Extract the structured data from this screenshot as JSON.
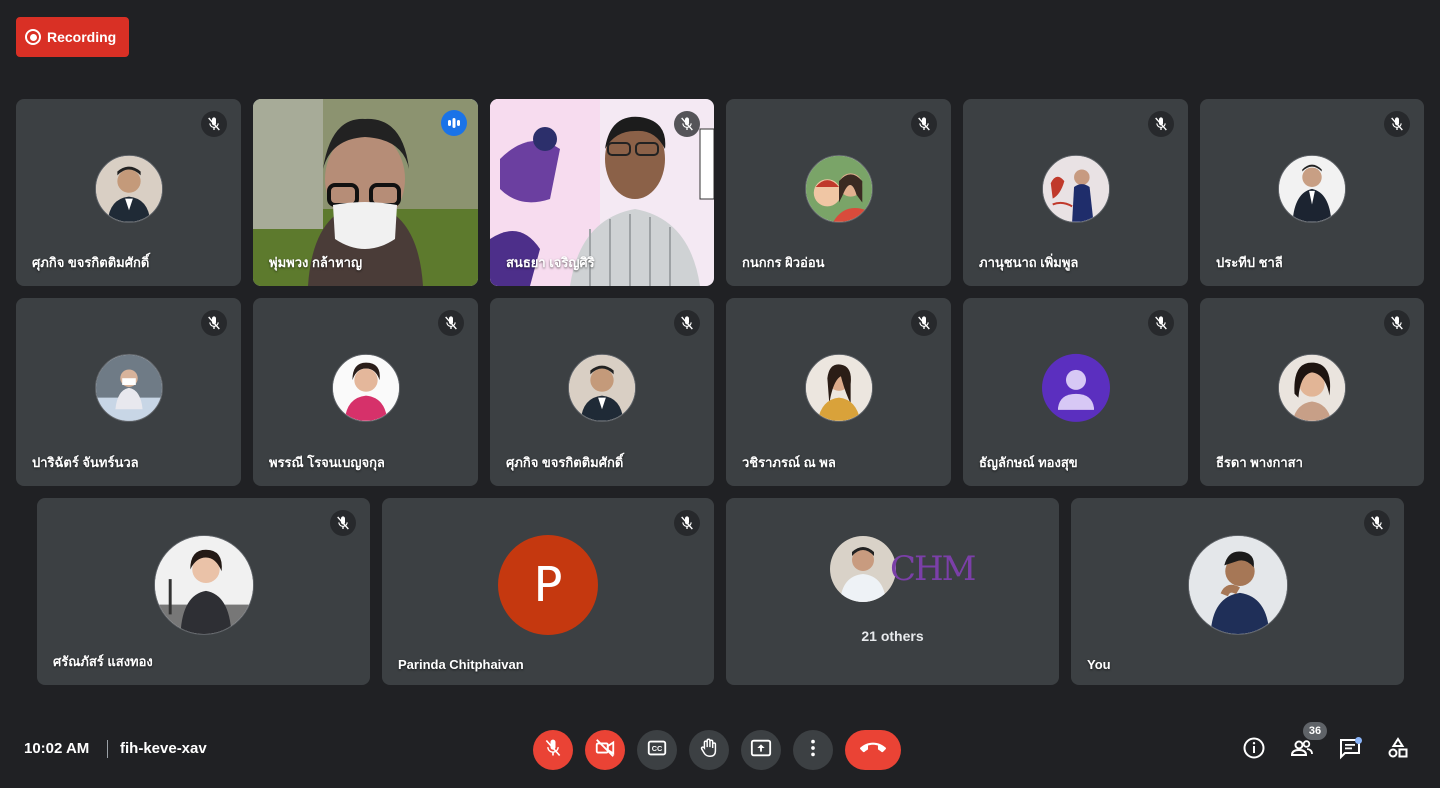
{
  "recording": {
    "label": "Recording"
  },
  "colors": {
    "background": "#202124",
    "tile": "#3c4043",
    "red": "#ea4335",
    "speaking": "#1a73e8",
    "accent_border": "#8ab4f8"
  },
  "tiles": [
    {
      "name": "ศุภกิจ ขจรกิตติมศักดิ์",
      "muted": true
    },
    {
      "name": "พุ่มพวง กล้าหาญ",
      "muted": false,
      "speaking": true,
      "video": true
    },
    {
      "name": "สนธยา เจริญศิริ",
      "muted": true,
      "video": true
    },
    {
      "name": "กนกกร ผิวอ่อน",
      "muted": true
    },
    {
      "name": "ภานุชนาถ เพิ่มพูล",
      "muted": true
    },
    {
      "name": "ประทีป ชาลี",
      "muted": true
    },
    {
      "name": "ปาริฉัตร์ จันทร์นวล",
      "muted": true
    },
    {
      "name": "พรรณี โรจนเบญจกุล",
      "muted": true
    },
    {
      "name": "ศุภกิจ ขจรกิตติมศักดิ์",
      "muted": true
    },
    {
      "name": "วชิราภรณ์ ณ พล",
      "muted": true
    },
    {
      "name": "ธัญลักษณ์ ทองสุข",
      "muted": true
    },
    {
      "name": "ธีรดา พางกาสา",
      "muted": true
    },
    {
      "name": "ศรัณภัสร์ แสงทอง",
      "muted": true
    },
    {
      "name": "Parinda Chitphaivan",
      "muted": true,
      "avatar_letter": "P"
    },
    {
      "name": "21 others",
      "muted": false,
      "others_logo": "CHM"
    },
    {
      "name": "You",
      "muted": true
    }
  ],
  "meeting": {
    "time": "10:02 AM",
    "code": "fih-keve-xav"
  },
  "controls": [
    {
      "name": "microphone-off",
      "icon": "mic-off-icon"
    },
    {
      "name": "camera-off",
      "icon": "videocam-off-icon"
    },
    {
      "name": "captions",
      "icon": "cc-icon"
    },
    {
      "name": "raise-hand",
      "icon": "hand-icon"
    },
    {
      "name": "present",
      "icon": "present-icon"
    },
    {
      "name": "more-options",
      "icon": "more-vert-icon"
    },
    {
      "name": "leave-call",
      "icon": "call-end-icon"
    }
  ],
  "side_controls": {
    "participants_count": "36"
  }
}
